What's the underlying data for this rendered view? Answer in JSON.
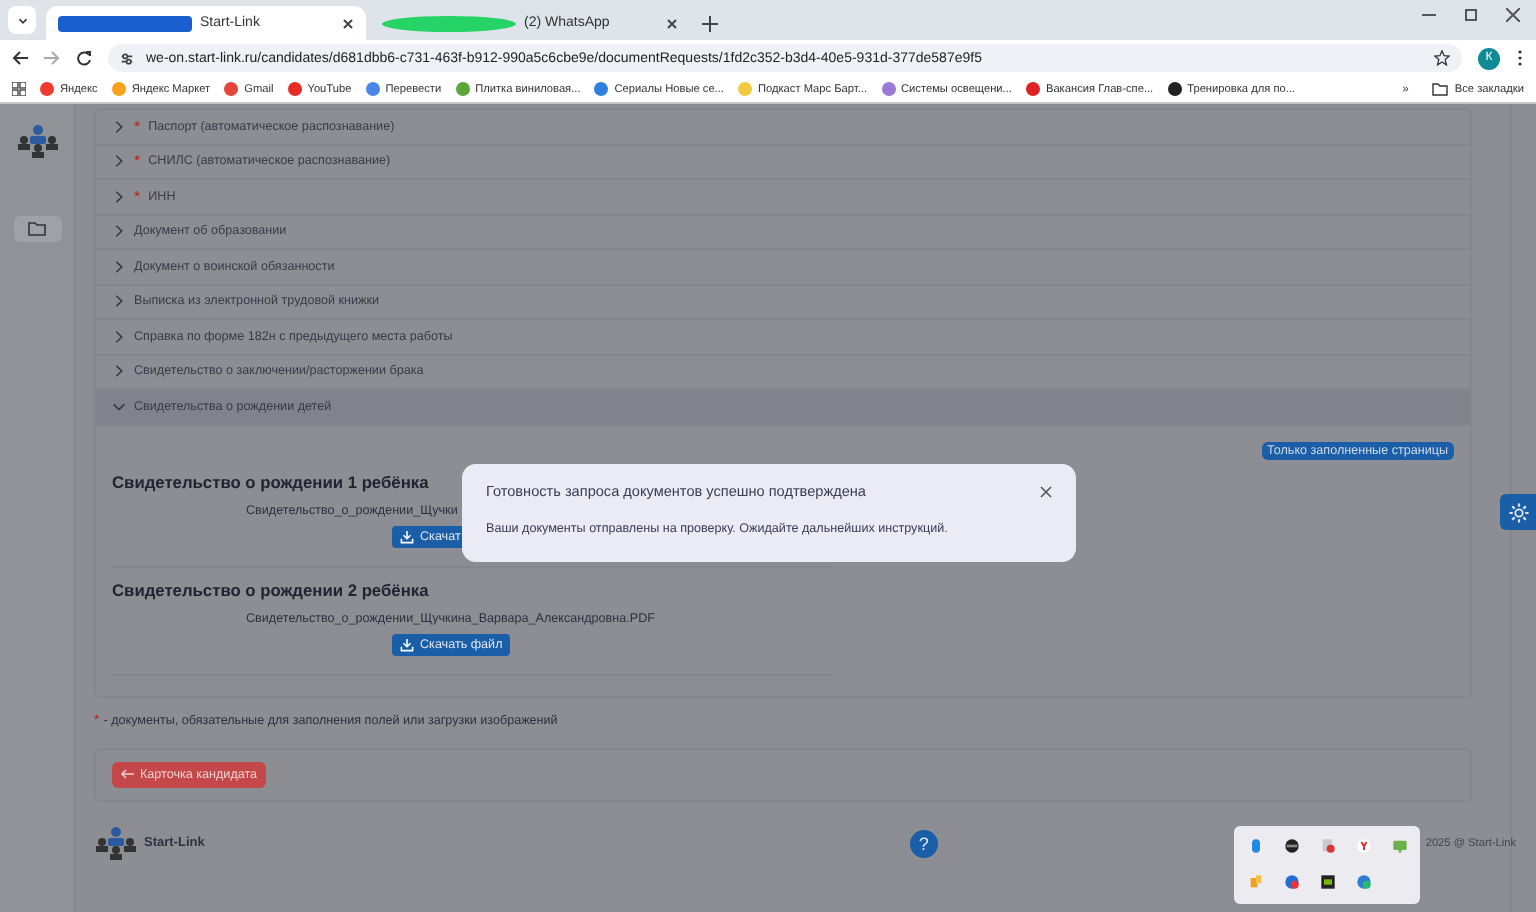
{
  "browser": {
    "tabs": [
      {
        "title": "Start-Link",
        "selected": true
      },
      {
        "title": "(2) WhatsApp",
        "selected": false
      }
    ],
    "url": "we-on.start-link.ru/candidates/d681dbb6-c731-463f-b912-990a5c6cbe9e/documentRequests/1fd2c352-b3d4-40e5-931d-377de587e9f5",
    "avatar": "К",
    "bookmarks": [
      {
        "label": "Яндекс",
        "color": "#f03a2e"
      },
      {
        "label": "Яндекс Маркет",
        "color": "#f8a21c"
      },
      {
        "label": "Gmail",
        "color": "#e5463a"
      },
      {
        "label": "YouTube",
        "color": "#e52d27"
      },
      {
        "label": "Перевести",
        "color": "#4a86e8"
      },
      {
        "label": "Плитка виниловая...",
        "color": "#5aa63a"
      },
      {
        "label": "Сериалы Новые се...",
        "color": "#2f7fe0"
      },
      {
        "label": "Подкаст Марс Барт...",
        "color": "#f5c842"
      },
      {
        "label": "Системы освещени...",
        "color": "#9b7ad6"
      },
      {
        "label": "Вакансия Глав-спе...",
        "color": "#e02020"
      },
      {
        "label": "Тренировка для по...",
        "color": "#222222"
      }
    ],
    "more": "»",
    "all_bookmarks": "Все закладки"
  },
  "documents": [
    {
      "mark": "*",
      "label": "Паспорт (автоматическое распознавание)",
      "expanded": false
    },
    {
      "mark": "*",
      "label": "СНИЛС (автоматическое распознавание)",
      "expanded": false
    },
    {
      "mark": "*",
      "label": "ИНН",
      "expanded": false
    },
    {
      "label": "Документ об образовании",
      "expanded": false
    },
    {
      "label": "Документ о воинской обязанности",
      "expanded": false
    },
    {
      "label": "Выписка из электронной трудовой книжки",
      "expanded": false
    },
    {
      "label": "Справка по форме 182н с предыдущего места работы",
      "expanded": false
    },
    {
      "label": "Свидетельство о заключении/расторжении брака",
      "expanded": false
    },
    {
      "label": "Свидетельства о рождении детей",
      "expanded": true
    }
  ],
  "filter_button": "Только заполненные страницы",
  "certificates": [
    {
      "title": "Свидетельство о рождении 1 ребёнка",
      "file": "Свидетельство_о_рождении_Щучки",
      "button": "Скачат"
    },
    {
      "title": "Свидетельство о рождении 2 ребёнка",
      "file": "Свидетельство_о_рождении_Щучкина_Варвара_Александровна.PDF",
      "button": "Скачать файл"
    }
  ],
  "note": {
    "mark": "*",
    "text": "- документы, обязательные для заполнения полей или загрузки изображений"
  },
  "back_button": "Карточка кандидата",
  "footer": {
    "brand": "Start-Link",
    "help": "?",
    "copyright": "2025 @ Start-Link"
  },
  "dialog": {
    "title": "Готовность запроса документов успешно подтверждена",
    "message": "Ваши документы отправлены на проверку. Ожидайте дальнейших инструкций."
  }
}
